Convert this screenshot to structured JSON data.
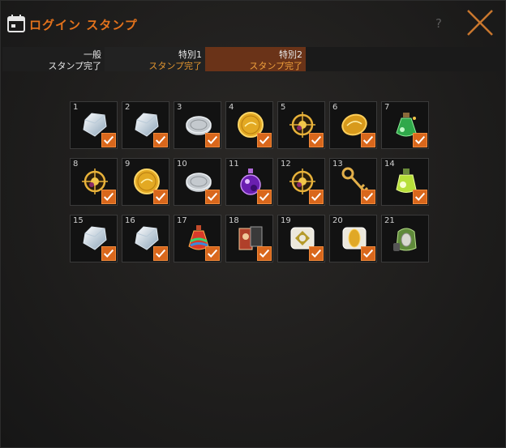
{
  "window": {
    "title": "ログイン スタンプ",
    "help": "?"
  },
  "tabs": [
    {
      "label": "一般",
      "status": "スタンプ完了"
    },
    {
      "label": "特別1",
      "status": "スタンプ完了"
    },
    {
      "label": "特別2",
      "status": "スタンプ完了",
      "active": true
    }
  ],
  "colors": {
    "accent": "#e3721c",
    "check": "#d9671c",
    "active_tab": "#6a3318"
  },
  "stamps": [
    {
      "day": "1",
      "item": "diamond-icon",
      "checked": true
    },
    {
      "day": "2",
      "item": "diamond-icon",
      "checked": true
    },
    {
      "day": "3",
      "item": "silver-coin-icon",
      "checked": true
    },
    {
      "day": "4",
      "item": "gold-coin-icon",
      "checked": true
    },
    {
      "day": "5",
      "item": "gold-compass-icon",
      "checked": true
    },
    {
      "day": "6",
      "item": "gold-coin-tilted-icon",
      "checked": true
    },
    {
      "day": "7",
      "item": "green-potion-icon",
      "checked": true
    },
    {
      "day": "8",
      "item": "gold-compass-icon",
      "checked": true
    },
    {
      "day": "9",
      "item": "gold-coin-icon",
      "checked": true
    },
    {
      "day": "10",
      "item": "silver-coin-icon",
      "checked": true
    },
    {
      "day": "11",
      "item": "purple-potion-icon",
      "checked": true
    },
    {
      "day": "12",
      "item": "gold-compass-icon",
      "checked": true
    },
    {
      "day": "13",
      "item": "gold-key-icon",
      "checked": true
    },
    {
      "day": "14",
      "item": "yellow-potion-icon",
      "checked": true
    },
    {
      "day": "15",
      "item": "diamond-icon",
      "checked": true
    },
    {
      "day": "16",
      "item": "diamond-icon",
      "checked": true
    },
    {
      "day": "17",
      "item": "rainbow-potion-icon",
      "checked": true
    },
    {
      "day": "18",
      "item": "cards-icon",
      "checked": true
    },
    {
      "day": "19",
      "item": "emblem-pillow-icon",
      "checked": true
    },
    {
      "day": "20",
      "item": "gold-pillow-icon",
      "checked": true
    },
    {
      "day": "21",
      "item": "stone-bag-icon",
      "checked": false
    }
  ]
}
